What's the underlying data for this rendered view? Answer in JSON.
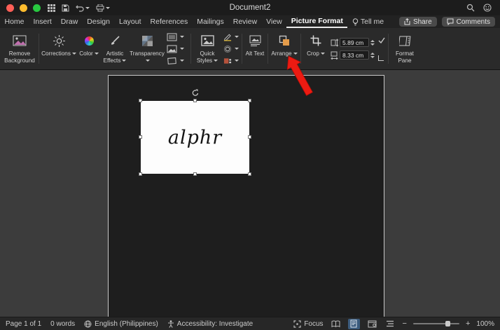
{
  "titlebar": {
    "title": "Document2"
  },
  "tabs": {
    "items": [
      {
        "label": "Home"
      },
      {
        "label": "Insert"
      },
      {
        "label": "Draw"
      },
      {
        "label": "Design"
      },
      {
        "label": "Layout"
      },
      {
        "label": "References"
      },
      {
        "label": "Mailings"
      },
      {
        "label": "Review"
      },
      {
        "label": "View"
      },
      {
        "label": "Picture Format"
      },
      {
        "label": "Tell me"
      }
    ],
    "share_label": "Share",
    "comments_label": "Comments"
  },
  "ribbon": {
    "remove_background_label": "Remove Background",
    "corrections_label": "Corrections",
    "color_label": "Color",
    "artistic_effects_label": "Artistic Effects",
    "transparency_label": "Transparency",
    "quick_styles_label": "Quick Styles",
    "alt_text_label": "Alt Text",
    "arrange_label": "Arrange",
    "crop_label": "Crop",
    "format_pane_label": "Format Pane",
    "size": {
      "height": "5.89 cm",
      "width": "8.33 cm"
    }
  },
  "document": {
    "picture_text": "alphr"
  },
  "statusbar": {
    "page_count": "Page 1 of 1",
    "word_count": "0 words",
    "language": "English (Philippines)",
    "accessibility": "Accessibility: Investigate",
    "focus_label": "Focus",
    "zoom_out_glyph": "−",
    "zoom_in_glyph": "+",
    "zoom_level": "100%"
  },
  "colors": {
    "annotation_arrow": "#ed1b12",
    "active_view_highlight": "#3b5b7d",
    "accent_orange": "#e49c4a"
  }
}
